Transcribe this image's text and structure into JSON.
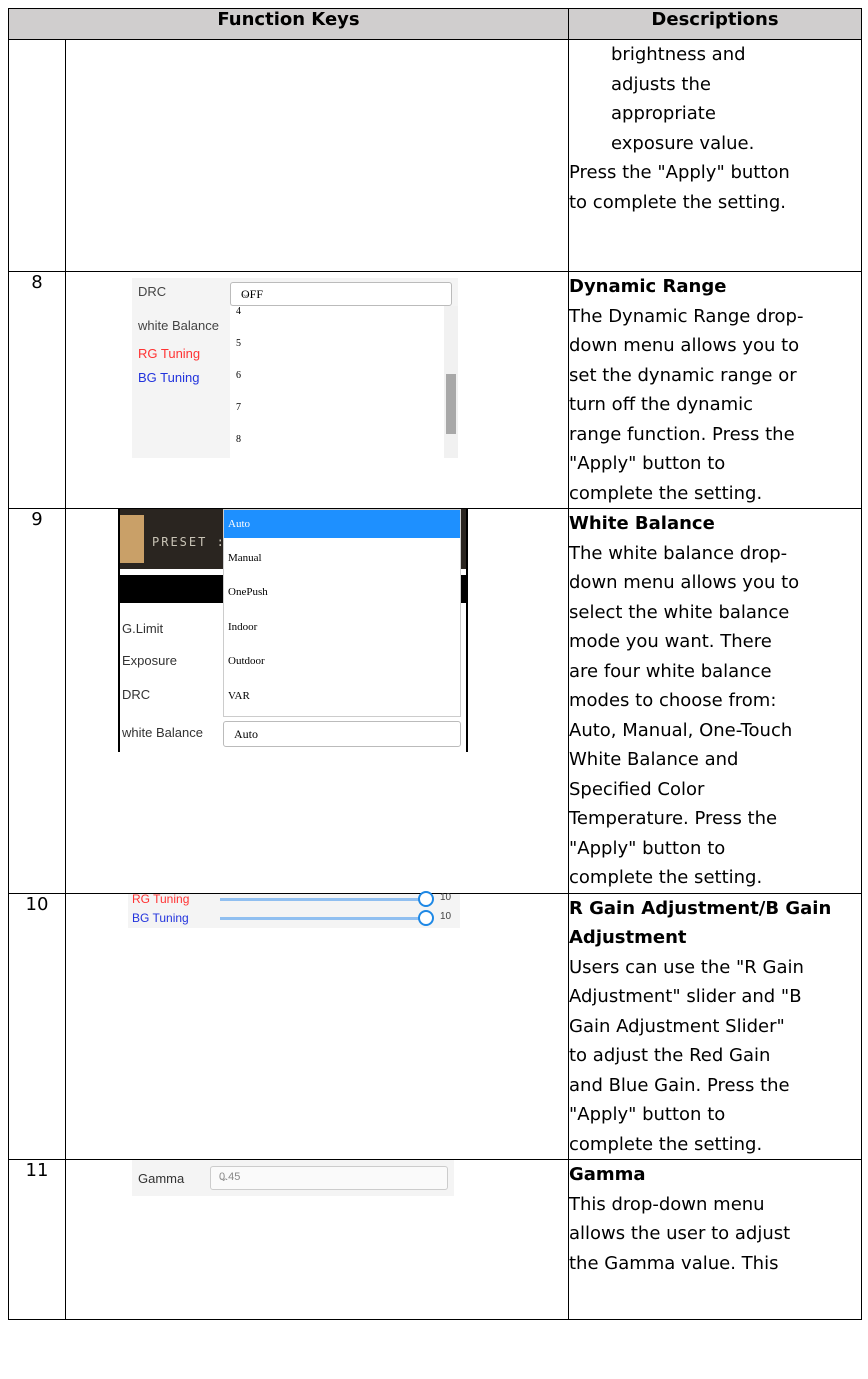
{
  "table": {
    "header_keys": "Function Keys",
    "header_desc": "Descriptions"
  },
  "row_cont": {
    "indent_lines": [
      "brightness and",
      "adjusts the",
      "appropriate",
      "exposure value."
    ],
    "lines": [
      "Press the \"Apply\" button",
      "to complete the setting."
    ]
  },
  "row8": {
    "num": "8",
    "title": "Dynamic Range",
    "lines": [
      "The Dynamic Range drop-",
      "down menu allows you to",
      "set the dynamic range or",
      "turn off the dynamic",
      "range function. Press the",
      "\"Apply\" button to",
      "complete the setting."
    ],
    "ui": {
      "labels": [
        "DRC",
        "white Balance",
        "RG Tuning",
        "BG Tuning"
      ],
      "label_colors": [
        "#444444",
        "#444444",
        "#ff3333",
        "#2233dd"
      ],
      "select_value": "OFF",
      "options": [
        "4",
        "5",
        "6",
        "7",
        "8"
      ]
    }
  },
  "row9": {
    "num": "9",
    "title": "White Balance",
    "lines": [
      "The white balance drop-",
      "down menu allows you to",
      "select the white balance",
      "mode you want. There",
      "are four white balance",
      "modes to choose from:",
      "Auto, Manual, One-Touch",
      "White Balance and",
      "Specified Color",
      "Temperature. Press the",
      "\"Apply\" button to",
      "complete the setting."
    ],
    "ui": {
      "preset_label": "PRESET :",
      "labels": [
        "G.Limit",
        "Exposure",
        "DRC",
        "white Balance"
      ],
      "options": [
        "Auto",
        "Manual",
        "OnePush",
        "Indoor",
        "Outdoor",
        "VAR"
      ],
      "select_value": "Auto",
      "accent": "#1e90ff"
    }
  },
  "row10": {
    "num": "10",
    "title": "R Gain Adjustment/B Gain Adjustment",
    "lines": [
      "Users can use the \"R Gain",
      "Adjustment\" slider and \"B",
      "Gain Adjustment Slider\"",
      "to adjust the Red Gain",
      "and Blue Gain. Press the",
      "\"Apply\" button to",
      "complete the setting."
    ],
    "ui": {
      "sliders": [
        {
          "label": "RG Tuning",
          "value": "10",
          "color": "#ff3333",
          "level": 1.0
        },
        {
          "label": "BG Tuning",
          "value": "10",
          "color": "#2233dd",
          "level": 1.0
        }
      ]
    }
  },
  "row11": {
    "num": "11",
    "title": "Gamma",
    "lines": [
      "This drop-down menu",
      "allows the user to adjust",
      "the Gamma value. This"
    ],
    "ui": {
      "label": "Gamma",
      "select_value": "0.45"
    }
  }
}
